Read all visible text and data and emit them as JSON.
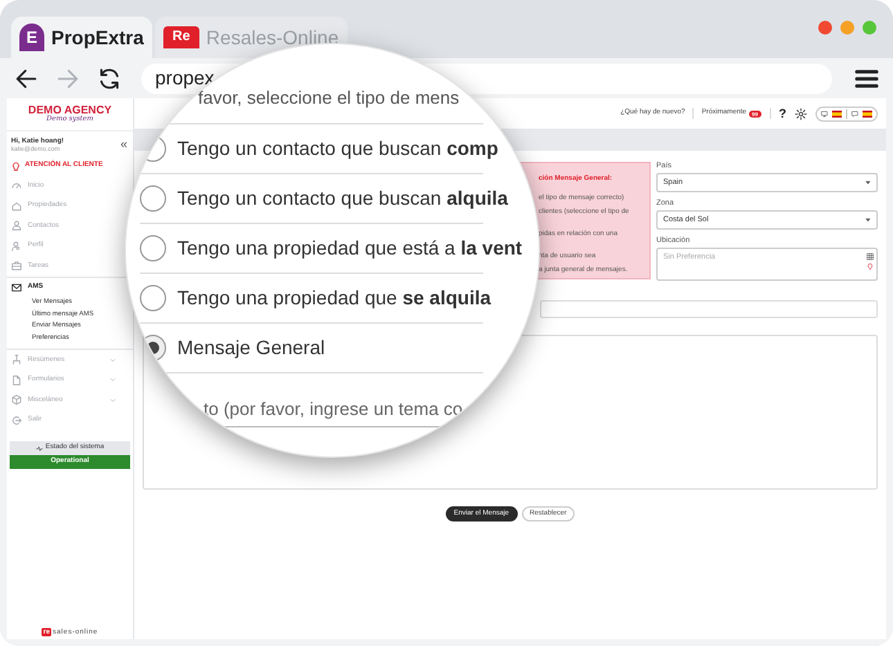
{
  "browser": {
    "tabs": [
      {
        "label": "PropExtra",
        "badge": "E",
        "selected": true
      },
      {
        "label": "Resales-Online",
        "badge": "Re",
        "selected": false
      }
    ],
    "nav_buttons": [
      {
        "kind": "back",
        "disabled": false
      },
      {
        "kind": "forward",
        "disabled": true
      },
      {
        "kind": "reload",
        "disabled": false
      }
    ],
    "url": "propex"
  },
  "sidebar": {
    "logo_title": "DEMO AGENCY",
    "logo_subtitle": "Demo system",
    "greeting": "Hi, Katie hoang!",
    "email": "katie@demo.com",
    "collapse": "«",
    "support": "ATENCIÓN AL CLIENTE",
    "items": [
      {
        "label": "Inicio",
        "selected": false,
        "expandable": false
      },
      {
        "label": "Propiedades",
        "selected": false,
        "expandable": false
      },
      {
        "label": "Contactos",
        "selected": false,
        "expandable": false
      },
      {
        "label": "Perfil",
        "selected": false,
        "expandable": false
      },
      {
        "label": "Tareas",
        "selected": false,
        "expandable": false
      },
      {
        "label": "AMS",
        "selected": true,
        "expandable": false,
        "children": [
          {
            "label": "Ver Mensajes"
          },
          {
            "label": "Último mensaje AMS"
          },
          {
            "label": "Enviar Mensajes"
          },
          {
            "label": "Preferencias"
          }
        ]
      },
      {
        "label": "Resúmenes",
        "selected": false,
        "expandable": true
      },
      {
        "label": "Formularios",
        "selected": false,
        "expandable": true
      },
      {
        "label": "Misceláneo",
        "selected": false,
        "expandable": true
      },
      {
        "label": "Salir",
        "selected": false,
        "expandable": false
      }
    ],
    "status": {
      "label": "Estado del sistema",
      "value": "Operational"
    },
    "footer_logo": {
      "mark": "re",
      "text": "sales-online"
    }
  },
  "topbar": {
    "whats_new": "¿Qué hay de nuevo?",
    "coming_soon": "Próximamente",
    "badge": "99",
    "help": "?"
  },
  "magnifier": {
    "prompt": "favor, seleccione el tipo de mens",
    "options": [
      {
        "label": "Tengo un contacto que buscan **comp**",
        "selected": false
      },
      {
        "label": "Tengo un contacto que buscan **alquila**",
        "selected": false
      },
      {
        "label": "Tengo una propiedad que está a **la vent**",
        "selected": false
      },
      {
        "label": "Tengo una propiedad que **se alquila**",
        "selected": false
      },
      {
        "label": "Mensaje General",
        "selected": true
      }
    ],
    "subject": "to (por favor, ingrese un tema co"
  },
  "notice": {
    "title": "ción Mensaje General:",
    "paragraphs": [
      [
        "el tipo de mensaje correcto)",
        "clientes (seleccione el tipo de"
      ],
      [
        "pidas en relación con una"
      ],
      [
        "nta de usuario sea",
        "a junta general de mensajes."
      ]
    ]
  },
  "fields": [
    {
      "kind": "select",
      "label": "País",
      "value": "Spain"
    },
    {
      "kind": "select",
      "label": "Zona",
      "value": "Costa del Sol"
    },
    {
      "kind": "area",
      "label": "Ubicación",
      "placeholder": "Sin Preferencia"
    }
  ],
  "buttons": [
    {
      "kind": "primary",
      "label": "Enviar el Mensaje"
    },
    {
      "kind": "secondary",
      "label": "Restablecer"
    }
  ]
}
